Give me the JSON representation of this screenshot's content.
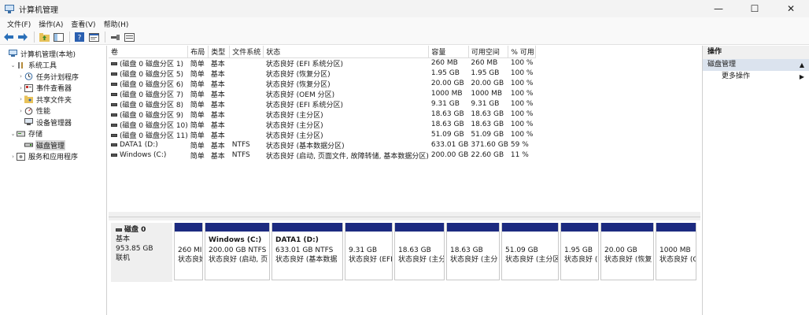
{
  "window": {
    "title": "计算机管理",
    "minimize": "—",
    "maximize": "☐",
    "close": "✕"
  },
  "menu": [
    "文件(F)",
    "操作(A)",
    "查看(V)",
    "帮助(H)"
  ],
  "tree": [
    {
      "label": "计算机管理(本地)",
      "depth": 0,
      "twisty": "",
      "icon": "computer-icon"
    },
    {
      "label": "系统工具",
      "depth": 1,
      "twisty": "⌄",
      "icon": "tools-icon"
    },
    {
      "label": "任务计划程序",
      "depth": 2,
      "twisty": "›",
      "icon": "clock-icon"
    },
    {
      "label": "事件查看器",
      "depth": 2,
      "twisty": "›",
      "icon": "event-viewer-icon"
    },
    {
      "label": "共享文件夹",
      "depth": 2,
      "twisty": "›",
      "icon": "shared-folder-icon"
    },
    {
      "label": "性能",
      "depth": 2,
      "twisty": "›",
      "icon": "performance-icon"
    },
    {
      "label": "设备管理器",
      "depth": 2,
      "twisty": "",
      "icon": "device-manager-icon"
    },
    {
      "label": "存储",
      "depth": 1,
      "twisty": "⌄",
      "icon": "storage-icon"
    },
    {
      "label": "磁盘管理",
      "depth": 2,
      "twisty": "",
      "icon": "disk-icon",
      "selected": true
    },
    {
      "label": "服务和应用程序",
      "depth": 1,
      "twisty": "›",
      "icon": "services-icon"
    }
  ],
  "volumes": {
    "columns": [
      "卷",
      "布局",
      "类型",
      "文件系统",
      "状态",
      "容量",
      "可用空间",
      "% 可用"
    ],
    "rows": [
      [
        "(磁盘 0 磁盘分区 1)",
        "简单",
        "基本",
        "",
        "状态良好 (EFI 系统分区)",
        "260 MB",
        "260 MB",
        "100 %"
      ],
      [
        "(磁盘 0 磁盘分区 5)",
        "简单",
        "基本",
        "",
        "状态良好 (恢复分区)",
        "1.95 GB",
        "1.95 GB",
        "100 %"
      ],
      [
        "(磁盘 0 磁盘分区 6)",
        "简单",
        "基本",
        "",
        "状态良好 (恢复分区)",
        "20.00 GB",
        "20.00 GB",
        "100 %"
      ],
      [
        "(磁盘 0 磁盘分区 7)",
        "简单",
        "基本",
        "",
        "状态良好 (OEM 分区)",
        "1000 MB",
        "1000 MB",
        "100 %"
      ],
      [
        "(磁盘 0 磁盘分区 8)",
        "简单",
        "基本",
        "",
        "状态良好 (EFI 系统分区)",
        "9.31 GB",
        "9.31 GB",
        "100 %"
      ],
      [
        "(磁盘 0 磁盘分区 9)",
        "简单",
        "基本",
        "",
        "状态良好 (主分区)",
        "18.63 GB",
        "18.63 GB",
        "100 %"
      ],
      [
        "(磁盘 0 磁盘分区 10)",
        "简单",
        "基本",
        "",
        "状态良好 (主分区)",
        "18.63 GB",
        "18.63 GB",
        "100 %"
      ],
      [
        "(磁盘 0 磁盘分区 11)",
        "简单",
        "基本",
        "",
        "状态良好 (主分区)",
        "51.09 GB",
        "51.09 GB",
        "100 %"
      ],
      [
        "DATA1 (D:)",
        "简单",
        "基本",
        "NTFS",
        "状态良好 (基本数据分区)",
        "633.01 GB",
        "371.60 GB",
        "59 %"
      ],
      [
        "Windows (C:)",
        "简单",
        "基本",
        "NTFS",
        "状态良好 (启动, 页面文件, 故障转储, 基本数据分区)",
        "200.00 GB",
        "22.60 GB",
        "11 %"
      ]
    ]
  },
  "disk": {
    "name": "磁盘 0",
    "type": "基本",
    "size": "953.85 GB",
    "status": "联机",
    "partitions": [
      {
        "name": "",
        "size": "260 MI",
        "status": "状态良好"
      },
      {
        "name": "Windows  (C:)",
        "size": "200.00 GB NTFS",
        "status": "状态良好 (启动, 页"
      },
      {
        "name": "DATA1  (D:)",
        "size": "633.01 GB NTFS",
        "status": "状态良好 (基本数据"
      },
      {
        "name": "",
        "size": "9.31 GB",
        "status": "状态良好 (EFI"
      },
      {
        "name": "",
        "size": "18.63 GB",
        "status": "状态良好 (主分"
      },
      {
        "name": "",
        "size": "18.63 GB",
        "status": "状态良好 (主分"
      },
      {
        "name": "",
        "size": "51.09 GB",
        "status": "状态良好 (主分区"
      },
      {
        "name": "",
        "size": "1.95 GB",
        "status": "状态良好 ("
      },
      {
        "name": "",
        "size": "20.00 GB",
        "status": "状态良好 (恢复"
      },
      {
        "name": "",
        "size": "1000 MB",
        "status": "状态良好 (O"
      }
    ]
  },
  "actions": {
    "header": "操作",
    "section": "磁盘管理",
    "more": "更多操作"
  }
}
